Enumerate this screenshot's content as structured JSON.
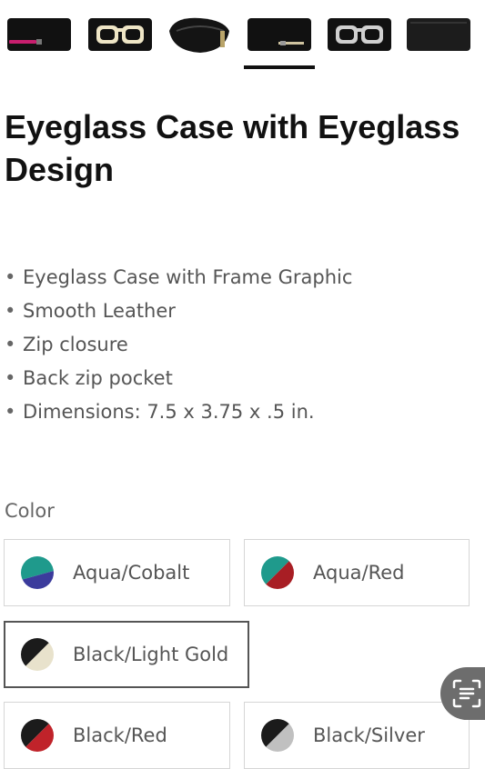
{
  "thumbnails": [
    {
      "icon": "case-magenta-zip-thumb"
    },
    {
      "icon": "case-cream-glasses-thumb"
    },
    {
      "icon": "case-open-pouch-thumb"
    },
    {
      "icon": "case-black-gold-thumb",
      "selected": true
    },
    {
      "icon": "case-silver-glasses-thumb"
    },
    {
      "icon": "case-plain-black-thumb"
    }
  ],
  "product": {
    "title": "Eyeglass Case with Eyeglass Design"
  },
  "features": [
    "Eyeglass Case with Frame Graphic",
    "Smooth Leather",
    "Zip closure",
    "Back zip pocket",
    "Dimensions: 7.5 x 3.75 x .5 in."
  ],
  "bullet": "•",
  "color": {
    "label": "Color",
    "options": [
      {
        "label": "Aqua/Cobalt",
        "colors": [
          "#1f9a8c",
          "#3b3b9c"
        ]
      },
      {
        "label": "Aqua/Red",
        "colors": [
          "#1f9a8c",
          "#a81e24"
        ]
      },
      {
        "label": "Black/Light Gold",
        "colors": [
          "#1b1b1b",
          "#e8e2cc"
        ],
        "selected": true
      },
      {
        "label": "Black/Red",
        "colors": [
          "#1b1b1b",
          "#c0232a"
        ]
      },
      {
        "label": "Black/Silver",
        "colors": [
          "#1b1b1b",
          "#c0c0c0"
        ]
      }
    ]
  },
  "colors": {
    "title": "#111111",
    "text_muted": "#555555",
    "border": "#d6d6d6",
    "selected_border": "#555555"
  },
  "scan_button": {
    "icon": "text-scan-icon"
  }
}
